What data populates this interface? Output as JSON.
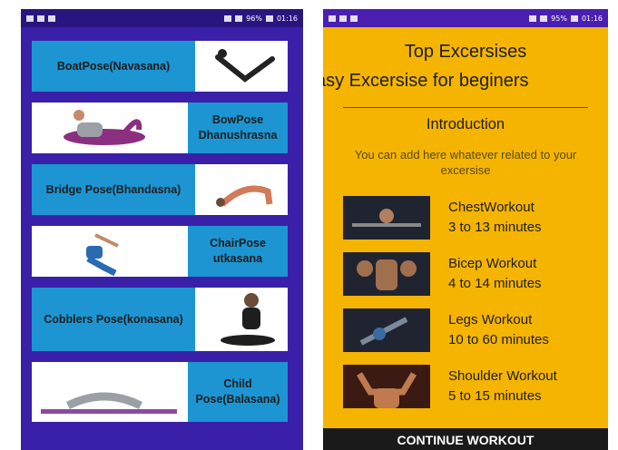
{
  "status_bar": {
    "battery": "96%",
    "time": "01:16"
  },
  "status_bar_right": {
    "battery": "95%",
    "time": "01:16"
  },
  "poses": [
    {
      "name": "BoatPose(Navasana)"
    },
    {
      "name": "BowPose Dhanushrasna"
    },
    {
      "name": "Bridge Pose(Bhandasna)"
    },
    {
      "name": "ChairPose utkasana"
    },
    {
      "name": "Cobblers Pose(konasana)"
    },
    {
      "name": "Child Pose(Balasana)"
    }
  ],
  "detail": {
    "title": "Top Excersises",
    "subtitle": "asy Excersise for beginers",
    "intro_heading": "Introduction",
    "intro_text": "You can add here whatever related to your excersise",
    "workouts": [
      {
        "name": "ChestWorkout",
        "duration": "3 to 13 minutes"
      },
      {
        "name": "Bicep Workout",
        "duration": "4 to 14 minutes"
      },
      {
        "name": "Legs Workout",
        "duration": "10 to 60 minutes"
      },
      {
        "name": "Shoulder Workout",
        "duration": "5 to 15 minutes"
      }
    ],
    "continue_label": "CONTINUE WORKOUT"
  },
  "colors": {
    "left_bg": "#3a20a8",
    "card_accent": "#1c95d2",
    "right_bg": "#f4b400",
    "cta_bg": "#1a1a1a"
  }
}
